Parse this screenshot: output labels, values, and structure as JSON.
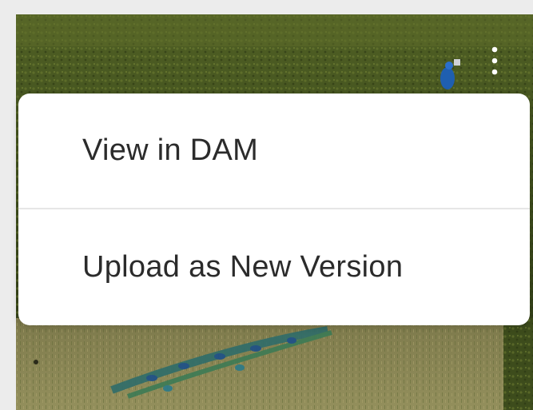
{
  "asset_card": {
    "image_description_icon": "peacock-photo",
    "more_icon": "vertical-ellipsis-icon"
  },
  "context_menu": {
    "items": [
      {
        "label": "View in DAM"
      },
      {
        "label": "Upload as New Version"
      }
    ]
  },
  "colors": {
    "menu_background": "#ffffff",
    "menu_text": "#2b2b2b",
    "divider": "#e6e6e6",
    "page_background": "#ececec"
  }
}
